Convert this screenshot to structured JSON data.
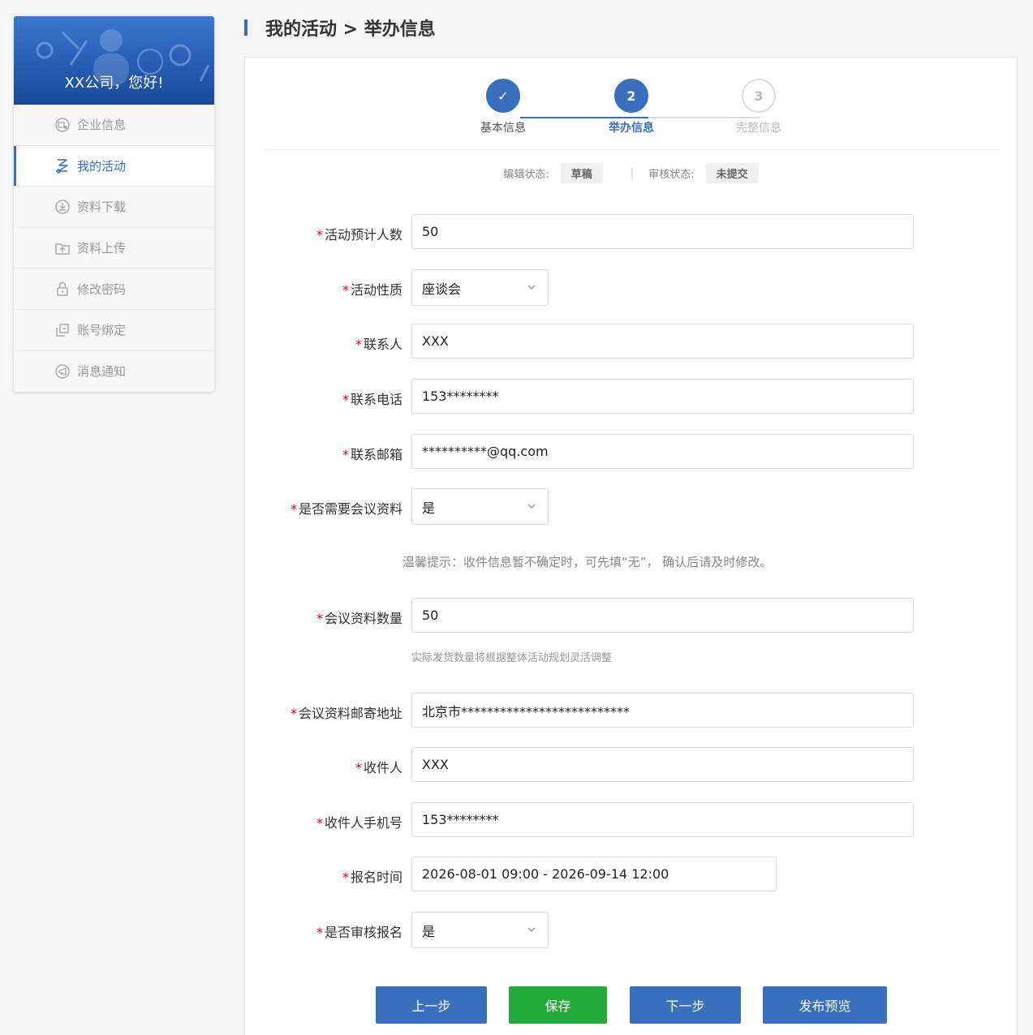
{
  "sidebar": {
    "greeting": "XX公司，您好!",
    "items": [
      {
        "label": "企业信息",
        "icon": "company-icon",
        "active": false
      },
      {
        "label": "我的活动",
        "icon": "activity-icon",
        "active": true
      },
      {
        "label": "资料下载",
        "icon": "download-icon",
        "active": false
      },
      {
        "label": "资料上传",
        "icon": "upload-icon",
        "active": false
      },
      {
        "label": "修改密码",
        "icon": "lock-icon",
        "active": false
      },
      {
        "label": "账号绑定",
        "icon": "link-icon",
        "active": false
      },
      {
        "label": "消息通知",
        "icon": "notification-icon",
        "active": false
      }
    ]
  },
  "header": {
    "title": "我的活动 > 举办信息"
  },
  "steps": [
    {
      "number": "✓",
      "label": "基本信息",
      "state": "done"
    },
    {
      "number": "2",
      "label": "举办信息",
      "state": "current"
    },
    {
      "number": "3",
      "label": "完整信息",
      "state": "todo"
    }
  ],
  "status": {
    "edit_label": "编辑状态:",
    "edit_value": "草稿",
    "separator": "|",
    "review_label": "审核状态:",
    "review_value": "未提交"
  },
  "form": {
    "required_mark": "*",
    "expected_count": {
      "label": "活动预计人数",
      "value": "50"
    },
    "activity_type": {
      "label": "活动性质",
      "value": "座谈会"
    },
    "contact": {
      "label": "联系人",
      "value": "XXX"
    },
    "contact_phone": {
      "label": "联系电话",
      "value": "153********"
    },
    "contact_email": {
      "label": "联系邮箱",
      "value": "**********@qq.com"
    },
    "need_materials": {
      "label": "是否需要会议资料",
      "value": "是"
    },
    "tip": "温馨提示：收件信息暂不确定时，可先填“无”， 确认后请及时修改。",
    "materials_count": {
      "label": "会议资料数量",
      "value": "50",
      "hint": "实际发货数量将根据整体活动规划灵活调整"
    },
    "mail_address": {
      "label": "会议资料邮寄地址",
      "value": "北京市**************************"
    },
    "recipient": {
      "label": "收件人",
      "value": "XXX"
    },
    "recipient_phone": {
      "label": "收件人手机号",
      "value": "153********"
    },
    "signup_time": {
      "label": "报名时间",
      "value": "2026-08-01 09:00 - 2026-09-14 12:00"
    },
    "review_signup": {
      "label": "是否审核报名",
      "value": "是"
    }
  },
  "buttons": {
    "prev": "上一步",
    "save": "保存",
    "next": "下一步",
    "preview": "发布预览"
  },
  "colors": {
    "primary": "#3a6fbe",
    "success": "#22aa3a",
    "required": "#d9001b"
  }
}
